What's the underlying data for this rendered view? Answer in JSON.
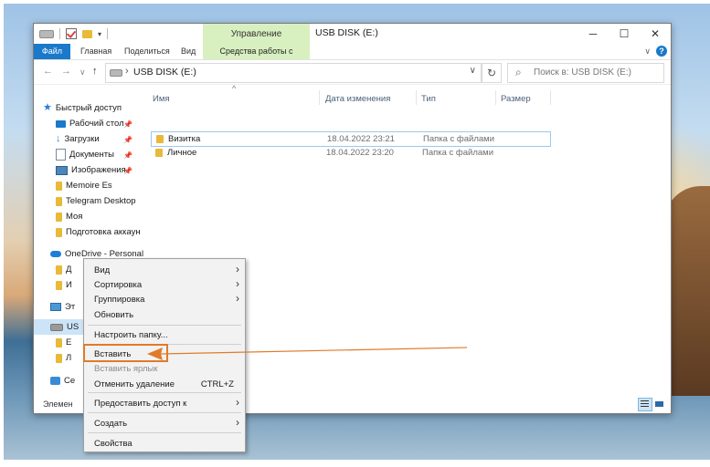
{
  "window": {
    "title": "USB DISK (E:)",
    "manage_top_label": "Управление"
  },
  "ribbon": {
    "tabs": [
      "Файл",
      "Главная",
      "Поделиться",
      "Вид"
    ],
    "manage_tab": "Средства работы с дисками"
  },
  "address": {
    "path": "USB DISK (E:)",
    "search_placeholder": "Поиск в: USB DISK (E:)"
  },
  "nav": {
    "items": [
      {
        "label": "Быстрый доступ",
        "icon": "star-icon"
      },
      {
        "label": "Рабочий стол",
        "icon": "desktop-icon",
        "pinned": true
      },
      {
        "label": "Загрузки",
        "icon": "download-icon",
        "pinned": true
      },
      {
        "label": "Документы",
        "icon": "document-icon",
        "pinned": true
      },
      {
        "label": "Изображения",
        "icon": "pictures-icon",
        "pinned": true
      },
      {
        "label": "Memoire Es",
        "icon": "folder-icon"
      },
      {
        "label": "Telegram Desktop",
        "icon": "folder-icon"
      },
      {
        "label": "Моя",
        "icon": "folder-icon"
      },
      {
        "label": "Подготовка аккаун",
        "icon": "folder-icon"
      },
      {
        "label": "OneDrive - Personal",
        "icon": "onedrive-icon"
      },
      {
        "label": "Д",
        "icon": "folder-icon"
      },
      {
        "label": "И",
        "icon": "folder-icon"
      },
      {
        "label": "Эт",
        "icon": "this-pc-icon"
      },
      {
        "label": "US",
        "icon": "usb-drive-icon"
      },
      {
        "label": "E",
        "icon": "folder-icon"
      },
      {
        "label": "Л",
        "icon": "folder-icon"
      },
      {
        "label": "Се",
        "icon": "network-icon"
      }
    ]
  },
  "columns": [
    "Имя",
    "Дата изменения",
    "Тип",
    "Размер"
  ],
  "files": [
    {
      "name": "Визитка",
      "date": "18.04.2022 23:21",
      "type": "Папка с файлами"
    },
    {
      "name": "Личное",
      "date": "18.04.2022 23:20",
      "type": "Папка с файлами"
    }
  ],
  "status": {
    "text": "Элемен"
  },
  "context_menu": {
    "items": [
      {
        "label": "Вид",
        "submenu": true
      },
      {
        "label": "Сортировка",
        "submenu": true
      },
      {
        "label": "Группировка",
        "submenu": true
      },
      {
        "label": "Обновить"
      },
      {
        "label": "Настроить папку..."
      },
      {
        "label": "Вставить",
        "highlighted": true
      },
      {
        "label": "Вставить ярлык",
        "disabled": true
      },
      {
        "label": "Отменить удаление",
        "shortcut": "CTRL+Z"
      },
      {
        "label": "Предоставить доступ к",
        "submenu": true
      },
      {
        "label": "Создать",
        "submenu": true
      },
      {
        "label": "Свойства"
      }
    ],
    "submenu_glyph": "›"
  },
  "colors": {
    "accent": "#1979ca",
    "manage_tab_bg": "#d8f0c0",
    "annotation": "#e07b2a",
    "selection": "#cce4f7"
  }
}
